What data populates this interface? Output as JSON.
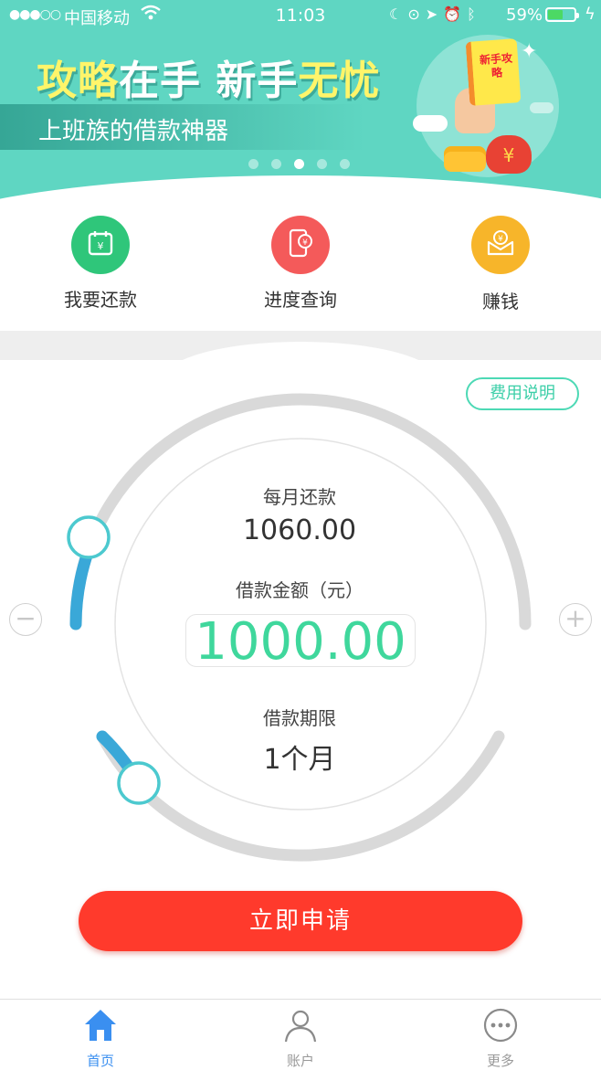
{
  "status_bar": {
    "signal": "●●●○○",
    "carrier": "中国移动",
    "time": "11:03",
    "battery_percent": "59%",
    "battery_level": 0.59
  },
  "banner": {
    "headline_part1": "攻略",
    "headline_part2": "在手 新手",
    "headline_part3": "无忧",
    "subtitle": "上班族的借款神器",
    "book_text": "新手攻略",
    "page_count": 5,
    "active_page": 3
  },
  "quick_actions": [
    {
      "label": "我要还款",
      "icon": "calendar-yuan-icon",
      "color": "#2fc67a"
    },
    {
      "label": "进度查询",
      "icon": "phone-yuan-icon",
      "color": "#f45a5a"
    },
    {
      "label": "赚钱",
      "icon": "envelope-yuan-icon",
      "color": "#f7b52a"
    }
  ],
  "fee_button": "费用说明",
  "loan": {
    "monthly_label": "每月还款",
    "monthly_value": "1060.00",
    "amount_label": "借款金额（元）",
    "amount_value": "1000.00",
    "term_label": "借款期限",
    "term_value": "1个月",
    "minus": "−",
    "plus": "+"
  },
  "apply_button": "立即申请",
  "tabs": [
    {
      "label": "首页",
      "icon": "home-icon",
      "active": true
    },
    {
      "label": "账户",
      "icon": "user-icon",
      "active": false
    },
    {
      "label": "更多",
      "icon": "more-icon",
      "active": false
    }
  ],
  "colors": {
    "banner": "#5fd6c2",
    "accent_green": "#3fd79c",
    "slider_blue": "#3aa8d8",
    "apply_red": "#ff3a2c",
    "tab_active": "#3a8ff0"
  }
}
